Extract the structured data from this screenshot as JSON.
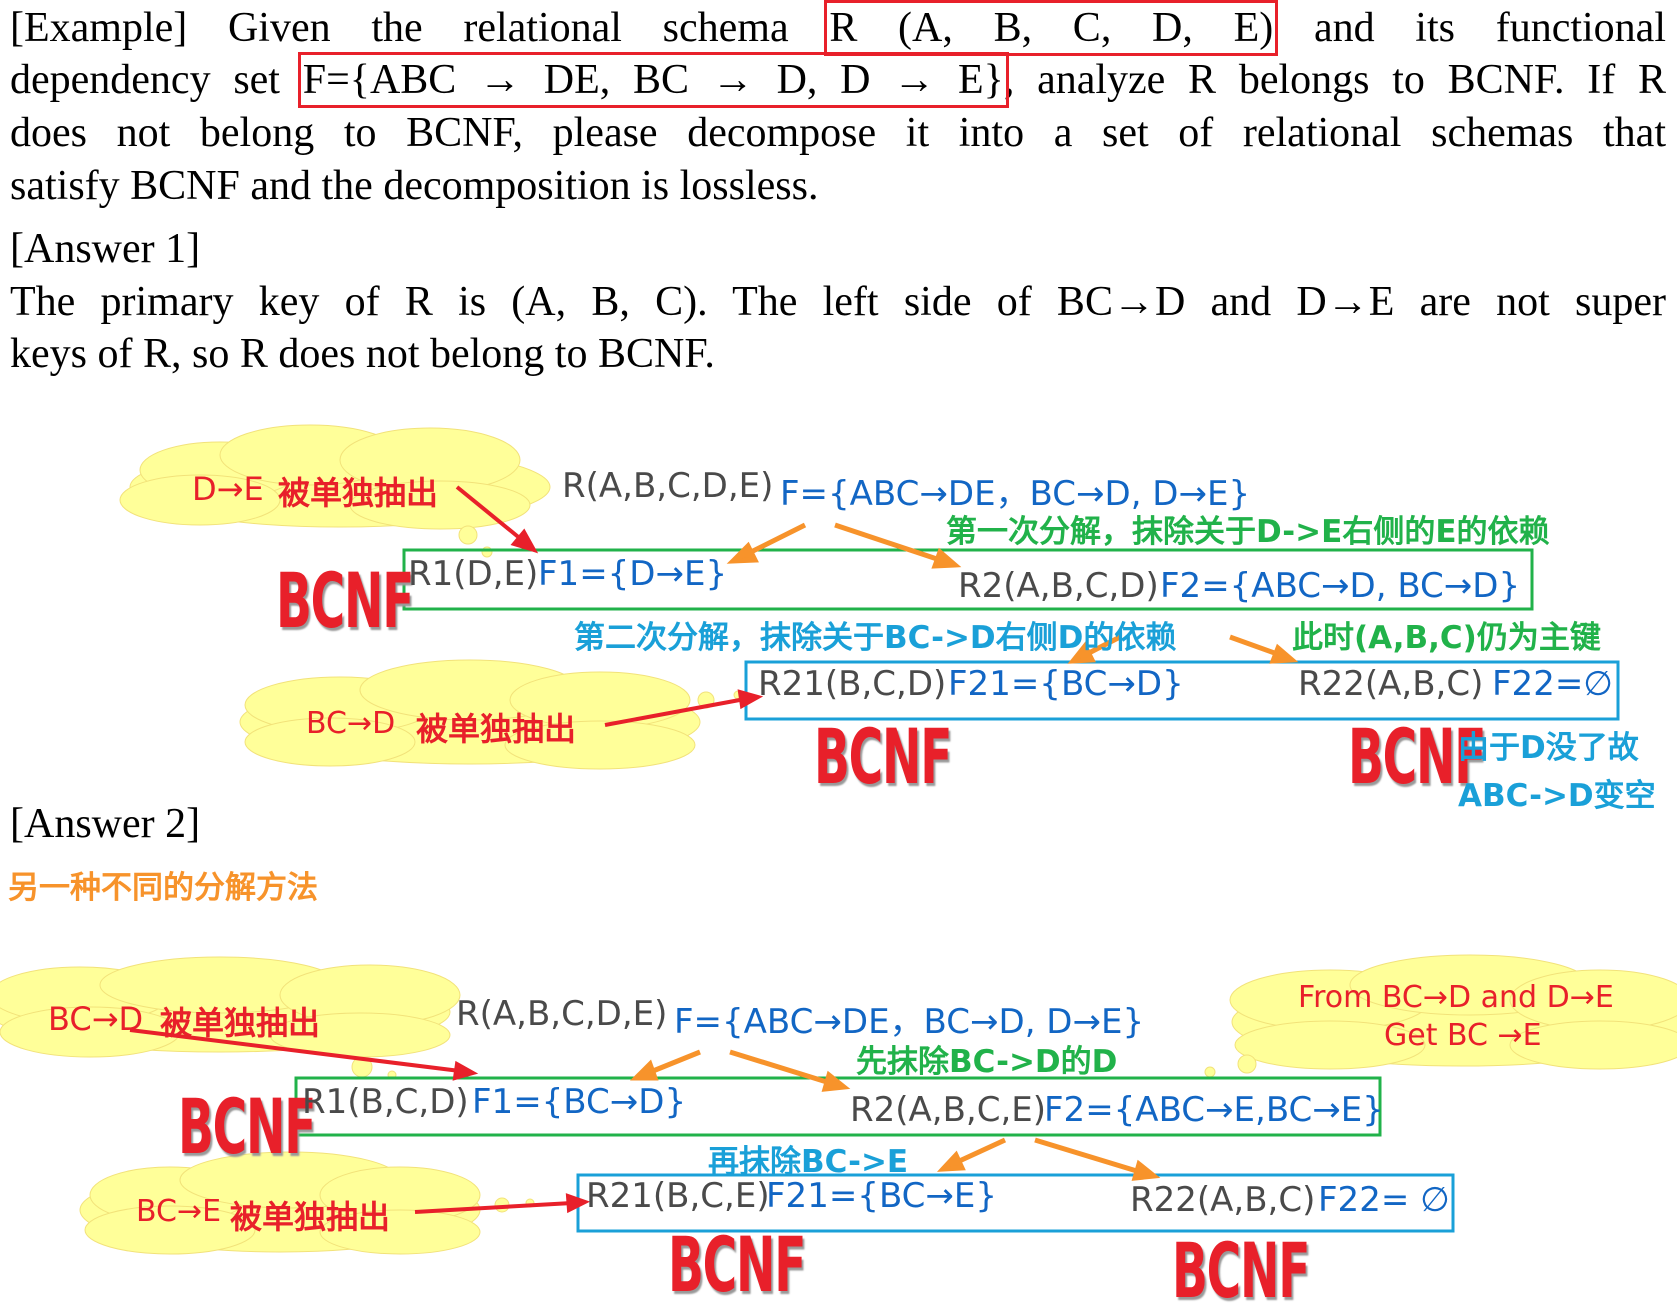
{
  "example": {
    "line1": {
      "pre": "[Example] Given the relational schema ",
      "boxed": "R (A, B, C, D, E)",
      "post": " and its functional"
    },
    "line2": {
      "pre": "dependency set ",
      "boxed": "F={ABC → DE, BC → D, D → E}",
      "post": ", analyze R belongs to BCNF. If R"
    },
    "line3": "does not belong to BCNF, please decompose it into a set of relational schemas that",
    "line4": "satisfy BCNF and the decomposition is lossless."
  },
  "answer1": {
    "heading": "[Answer 1]",
    "line1": "The primary key of R is (A, B, C). The left side of BC→D and D→E are not super",
    "line2": "keys of R, so R does not belong to BCNF.",
    "diagram": {
      "cloud1_label_a": "D→E",
      "cloud1_label_b": "被单独抽出",
      "root_schema": "R(A,B,C,D,E)",
      "root_fd": "F={ABC→DE，BC→D, D→E}",
      "step1_note": "第一次分解，抹除关于D->E右侧的E的依赖",
      "r1_schema": "R1(D,E)",
      "r1_fd": "F1={D→E}",
      "r2_schema": "R2(A,B,C,D)",
      "r2_fd": "F2={ABC→D, BC→D}",
      "bcnf_r1": "BCNF",
      "step2_note": "第二次分解，抹除关于BC->D右侧D的依赖",
      "key_note": "此时(A,B,C)仍为主键",
      "cloud2_label_a": "BC→D",
      "cloud2_label_b": "被单独抽出",
      "r21_schema": "R21(B,C,D)",
      "r21_fd": "F21={BC→D}",
      "r22_schema": "R22(A,B,C)",
      "r22_fd": "F22=∅",
      "bcnf_r21": "BCNF",
      "bcnf_r22": "BCNF",
      "empty_note_1": "由于D没了故",
      "empty_note_2": "ABC->D变空"
    }
  },
  "answer2": {
    "heading": "[Answer 2]",
    "subtitle": "另一种不同的分解方法",
    "diagram": {
      "cloud1_label_a": "BC→D",
      "cloud1_label_b": "被单独抽出",
      "root_schema": "R(A,B,C,D,E)",
      "root_fd": "F={ABC→DE，BC→D, D→E}",
      "cloud_right_1": "From BC→D and D→E",
      "cloud_right_2": "Get BC →E",
      "step1_note": "先抹除BC->D的D",
      "bcnf_r1": "BCNF",
      "r1_schema": "R1(B,C,D)",
      "r1_fd": "F1={BC→D}",
      "r2_schema": "R2(A,B,C,E)",
      "r2_fd": "F2={ABC→E,BC→E}",
      "step2_note": "再抹除BC->E",
      "cloud2_label_a": "BC→E",
      "cloud2_label_b": "被单独抽出",
      "r21_schema": "R21(B,C,E)",
      "r21_fd": "F21={BC→E}",
      "r22_schema": "R22(A,B,C)",
      "r22_fd": "F22= ∅",
      "bcnf_r21": "BCNF",
      "bcnf_r22": "BCNF"
    }
  },
  "colors": {
    "red": "#e8202a",
    "green": "#21b24a",
    "blue": "#1266c4",
    "cyan": "#1aa0d8",
    "orange": "#f7932b",
    "cloud": "#ffff99"
  }
}
